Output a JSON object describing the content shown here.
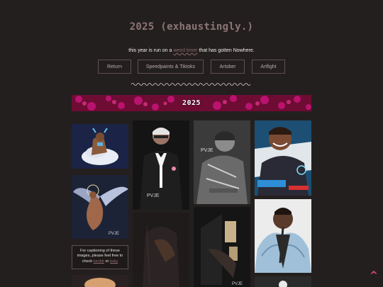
{
  "header": {
    "title": "2025 (exhaustingly.)",
    "subtitle_before": "this year is run on a ",
    "subtitle_link": "weird timer",
    "subtitle_after": " that has gotten Nowhere."
  },
  "nav": {
    "items": [
      {
        "label": "Return"
      },
      {
        "label": "Speedpaints & Tiktoks"
      },
      {
        "label": "Artober"
      },
      {
        "label": "Artfight"
      }
    ]
  },
  "banner": {
    "label": "2025",
    "color": "#7a0f3a"
  },
  "caption": {
    "line1": "For captioning of these images, please feel free to check ",
    "link1": "tumblr",
    "mid": " or ",
    "link2": "bsky"
  },
  "gallery": {
    "images": [
      {
        "icon": "artwork-image"
      },
      {
        "icon": "artwork-image"
      },
      {
        "icon": "artwork-image"
      },
      {
        "icon": "artwork-image"
      },
      {
        "icon": "artwork-image"
      },
      {
        "icon": "artwork-image"
      },
      {
        "icon": "artwork-image"
      },
      {
        "icon": "artwork-image"
      },
      {
        "icon": "artwork-image"
      },
      {
        "icon": "artwork-image"
      },
      {
        "icon": "artwork-image"
      }
    ]
  },
  "scroll_top": {
    "glyph": "^",
    "icon": "chevron-up-icon"
  },
  "colors": {
    "accent": "#8d7576",
    "link": "#8d6a6c",
    "banner": "#7a0f3a",
    "arrow": "#e04a7a"
  }
}
